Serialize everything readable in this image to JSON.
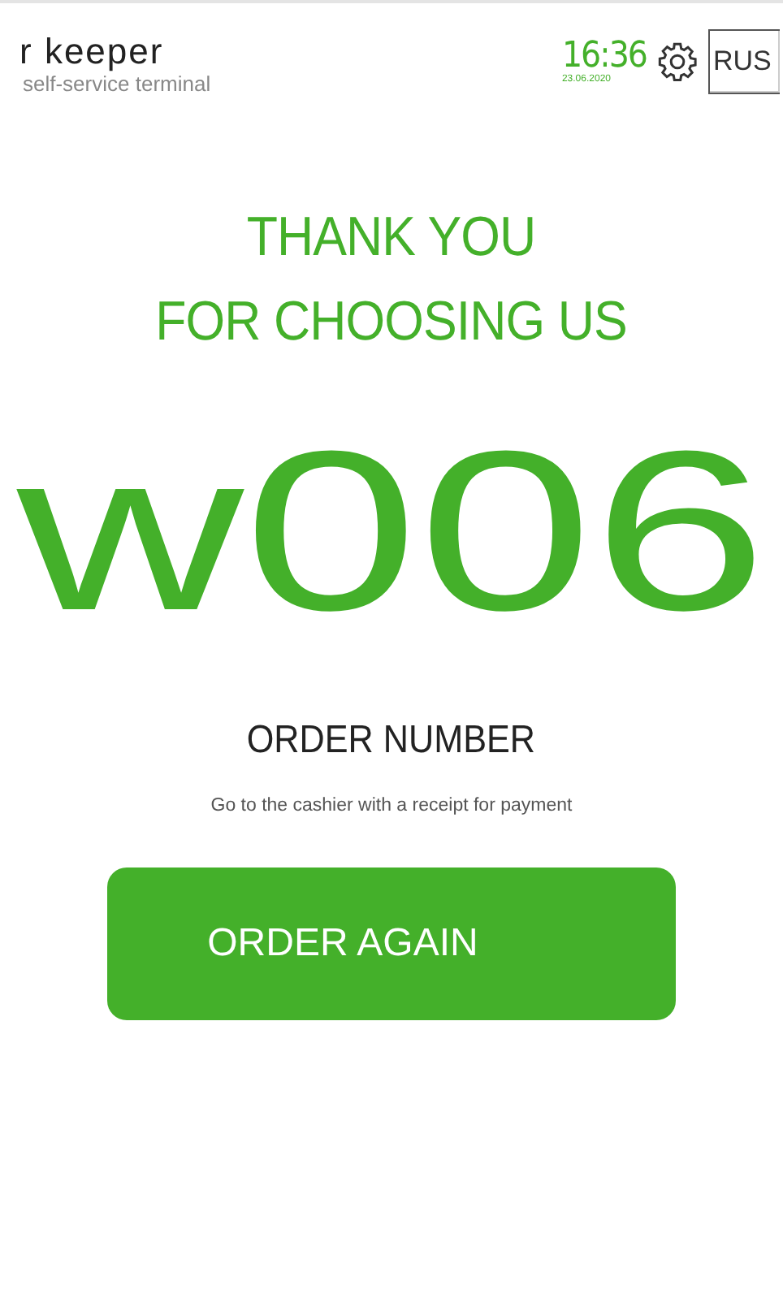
{
  "header": {
    "logo": "r keeper",
    "subtitle": "self-service terminal",
    "time": "16:36",
    "date": "23.06.2020",
    "language": "RUS"
  },
  "thanks": [
    "THANK YOU",
    "FOR CHOOSING US"
  ],
  "order": {
    "number": "w006",
    "label": "ORDER NUMBER",
    "hint": "Go to the cashier with a receipt for payment"
  },
  "button": "ORDER AGAIN"
}
